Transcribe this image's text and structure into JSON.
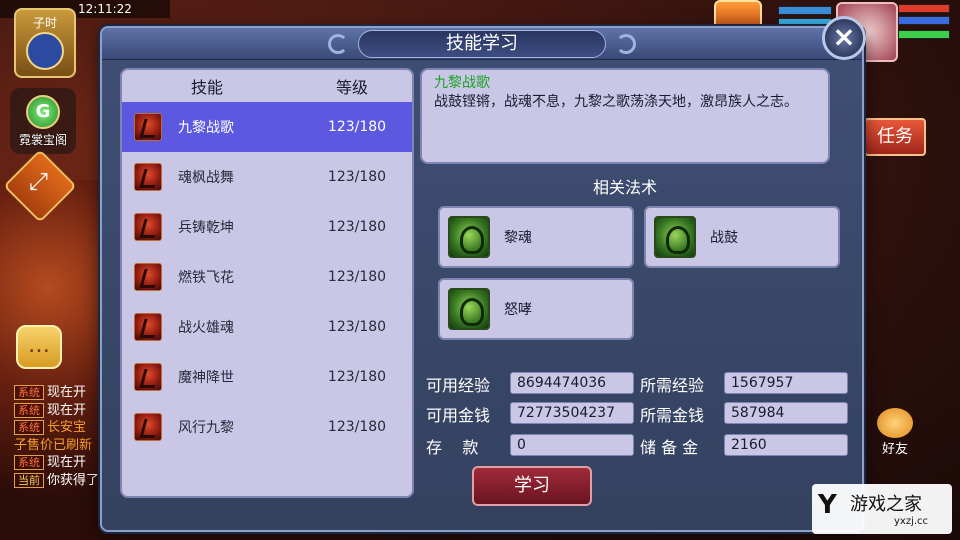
{
  "status_bar": {
    "time": "12:11:22"
  },
  "hud": {
    "shichen_label": "子时",
    "shop_label": "霓裳宝阁",
    "task_label": "任务",
    "friend_label": "好友"
  },
  "chat": [
    {
      "tag": "系统",
      "text": "现在开",
      "tag_type": "sys"
    },
    {
      "tag": "系统",
      "text": "现在开",
      "tag_type": "sys"
    },
    {
      "tag": "系统",
      "text": "长安宝",
      "tag_type": "sys"
    },
    {
      "tag": "",
      "text": "子售价已刷新",
      "tag_type": "none"
    },
    {
      "tag": "系统",
      "text": "现在开",
      "tag_type": "sys"
    },
    {
      "tag": "当前",
      "text": "你获得了",
      "tag_type": "cur"
    }
  ],
  "dialog": {
    "title": "技能学习",
    "close_icon": "close-icon",
    "skills_header": {
      "name": "技能",
      "level": "等级"
    },
    "skills": [
      {
        "name": "九黎战歌",
        "level": "123/180",
        "selected": true
      },
      {
        "name": "魂枫战舞",
        "level": "123/180",
        "selected": false
      },
      {
        "name": "兵铸乾坤",
        "level": "123/180",
        "selected": false
      },
      {
        "name": "燃铁飞花",
        "level": "123/180",
        "selected": false
      },
      {
        "name": "战火雄魂",
        "level": "123/180",
        "selected": false
      },
      {
        "name": "魔神降世",
        "level": "123/180",
        "selected": false
      },
      {
        "name": "风行九黎",
        "level": "123/180",
        "selected": false
      }
    ],
    "description": {
      "title": "九黎战歌",
      "text": "战鼓铿锵，战魂不息，九黎之歌荡涤天地，激昂族人之志。"
    },
    "related_title": "相关法术",
    "spells": [
      {
        "name": "黎魂"
      },
      {
        "name": "战鼓"
      },
      {
        "name": "怒哮"
      }
    ],
    "stats": {
      "available_exp_label": "可用经验",
      "available_exp": "8694474036",
      "required_exp_label": "所需经验",
      "required_exp": "1567957",
      "available_money_label": "可用金钱",
      "available_money": "72773504237",
      "required_money_label": "所需金钱",
      "required_money": "587984",
      "deposit_label": "存    款",
      "deposit": "0",
      "reserve_label": "储 备 金",
      "reserve": "2160"
    },
    "learn_button": "学习"
  },
  "watermark": {
    "mark": "Y",
    "name": "游戏之家",
    "url": "yxzj.cc"
  }
}
